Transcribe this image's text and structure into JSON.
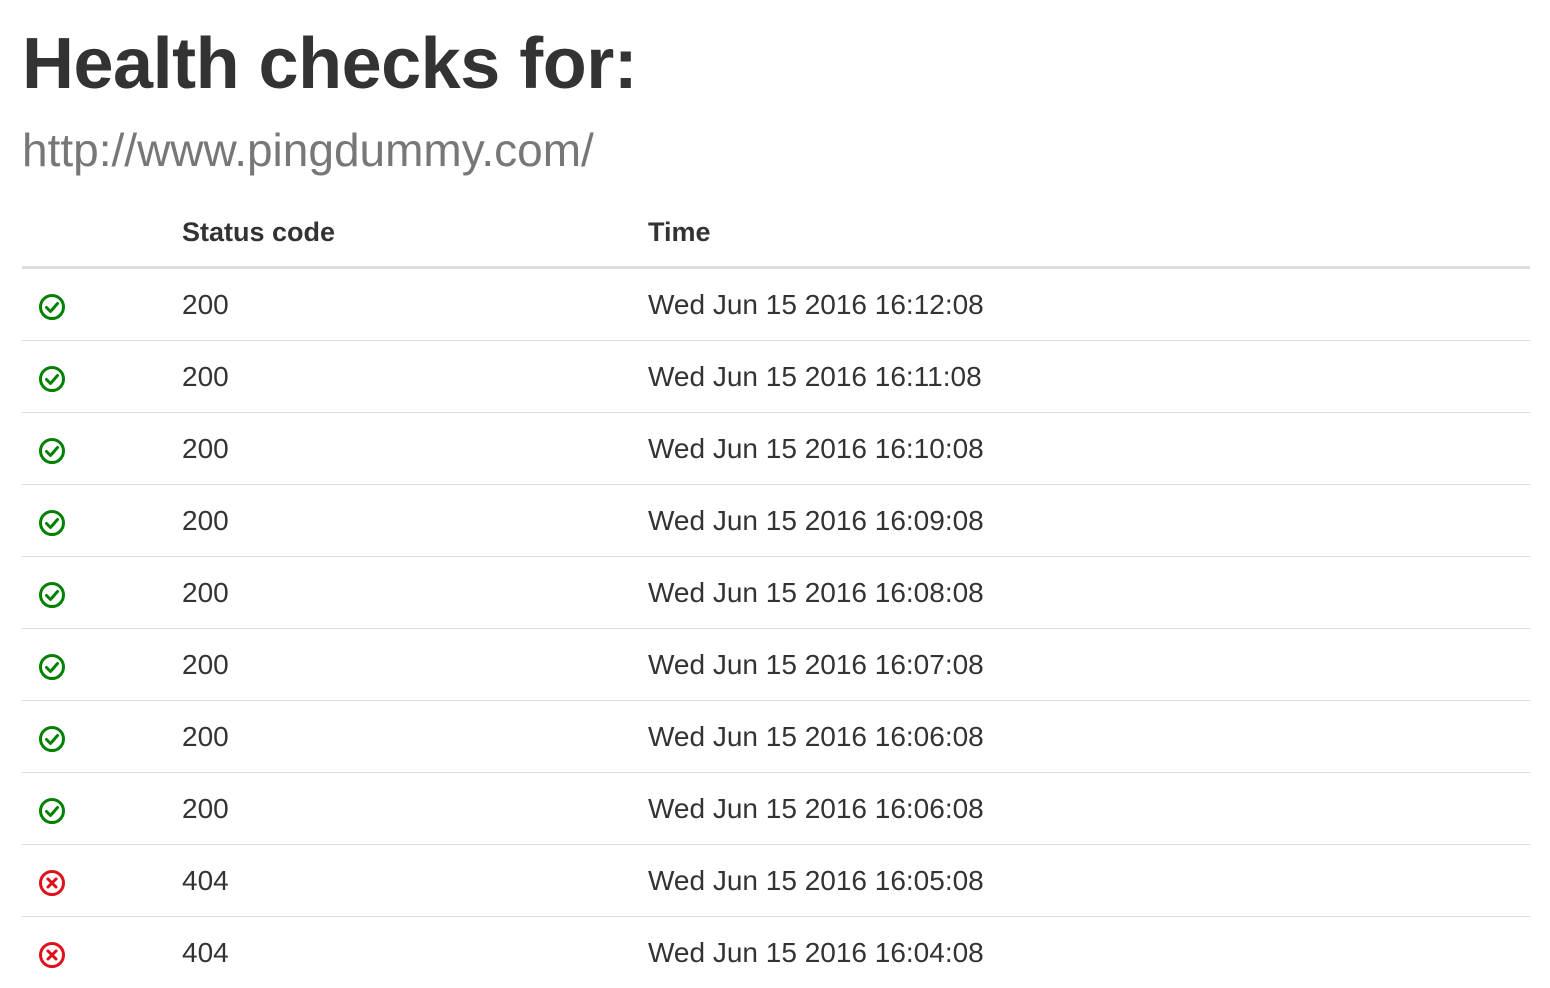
{
  "page": {
    "title": "Health checks for:",
    "url": "http://www.pingdummy.com/"
  },
  "table": {
    "headers": {
      "icon": "",
      "status_code": "Status code",
      "time": "Time"
    },
    "rows": [
      {
        "status": "success",
        "icon": "check-circle-icon",
        "code": "200",
        "time": "Wed Jun 15 2016 16:12:08"
      },
      {
        "status": "success",
        "icon": "check-circle-icon",
        "code": "200",
        "time": "Wed Jun 15 2016 16:11:08"
      },
      {
        "status": "success",
        "icon": "check-circle-icon",
        "code": "200",
        "time": "Wed Jun 15 2016 16:10:08"
      },
      {
        "status": "success",
        "icon": "check-circle-icon",
        "code": "200",
        "time": "Wed Jun 15 2016 16:09:08"
      },
      {
        "status": "success",
        "icon": "check-circle-icon",
        "code": "200",
        "time": "Wed Jun 15 2016 16:08:08"
      },
      {
        "status": "success",
        "icon": "check-circle-icon",
        "code": "200",
        "time": "Wed Jun 15 2016 16:07:08"
      },
      {
        "status": "success",
        "icon": "check-circle-icon",
        "code": "200",
        "time": "Wed Jun 15 2016 16:06:08"
      },
      {
        "status": "success",
        "icon": "check-circle-icon",
        "code": "200",
        "time": "Wed Jun 15 2016 16:06:08"
      },
      {
        "status": "error",
        "icon": "x-circle-icon",
        "code": "404",
        "time": "Wed Jun 15 2016 16:05:08"
      },
      {
        "status": "error",
        "icon": "x-circle-icon",
        "code": "404",
        "time": "Wed Jun 15 2016 16:04:08"
      }
    ]
  },
  "colors": {
    "success": "#008000",
    "error": "#e0101a",
    "text": "#333333",
    "subtitle": "#777777",
    "border": "#dddddd"
  }
}
